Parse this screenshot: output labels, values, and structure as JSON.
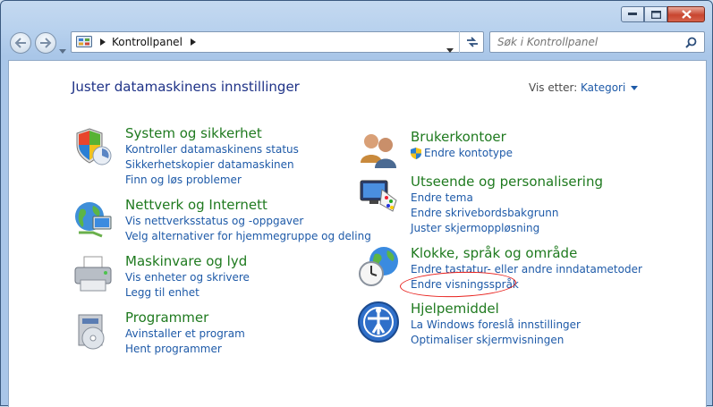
{
  "window": {
    "caption_buttons": {
      "minimize": "minimize",
      "maximize": "maximize",
      "close": "close"
    }
  },
  "address": {
    "segment": "Kontrollpanel"
  },
  "search": {
    "placeholder": "Søk i Kontrollpanel"
  },
  "header": {
    "title": "Juster datamaskinens innstillinger",
    "view_by_label": "Vis etter:",
    "view_by_value": "Kategori"
  },
  "categories": {
    "system": {
      "title": "System og sikkerhet",
      "links": [
        "Kontroller datamaskinens status",
        "Sikkerhetskopier datamaskinen",
        "Finn og løs problemer"
      ]
    },
    "network": {
      "title": "Nettverk og Internett",
      "links": [
        "Vis nettverksstatus og -oppgaver",
        "Velg alternativer for hjemmegruppe og deling"
      ]
    },
    "hardware": {
      "title": "Maskinvare og lyd",
      "links": [
        "Vis enheter og skrivere",
        "Legg til enhet"
      ]
    },
    "programs": {
      "title": "Programmer",
      "links": [
        "Avinstaller et program",
        "Hent programmer"
      ]
    },
    "accounts": {
      "title": "Brukerkontoer",
      "links": [
        "Endre kontotype"
      ]
    },
    "appearance": {
      "title": "Utseende og personalisering",
      "links": [
        "Endre tema",
        "Endre skrivebordsbakgrunn",
        "Juster skjermoppløsning"
      ]
    },
    "clock": {
      "title": "Klokke, språk og område",
      "links": [
        "Endre tastatur- eller andre inndatametoder",
        "Endre visningsspråk"
      ]
    },
    "ease": {
      "title": "Hjelpemiddel",
      "links": [
        "La Windows foreslå innstillinger",
        "Optimaliser skjermvisningen"
      ]
    }
  },
  "annotation": {
    "color": "#e8201c"
  }
}
